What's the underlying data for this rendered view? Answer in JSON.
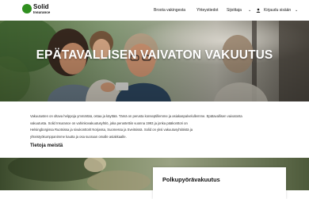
{
  "logo": {
    "name": "Solid",
    "tagline": "Insurance"
  },
  "nav": {
    "items": [
      {
        "label": "Broota vakingesta",
        "has_dropdown": false
      },
      {
        "label": "Yhteystiedot",
        "has_dropdown": false
      },
      {
        "label": "Sijoittaja",
        "has_dropdown": true
      },
      {
        "label": "Kirjaudu sisään",
        "has_dropdown": true
      }
    ],
    "user_icon": "user-icon",
    "caret_icon": "chevron-down-icon"
  },
  "hero": {
    "title": "EPÄTAVALLISEN VAIVATON VAKUUTUS"
  },
  "intro": {
    "lines": [
      "Vakuutusten on oltava helppoja ymmärtää, ostaa ja käyttää. Tämä on perusta konseptillemme ja asiakaspalvelullemme. Epätavallisen vaivatonta",
      "vakuutusta. Solid Insurance on vahinkovakuutusyhtiö, joka perustettiin vuonna 1993 ja jonka pääkonttori on",
      "Helsingborgissa Ruotsissa ja sivukonttorit Norjassa, Suomessa ja Sveitsissä. Solid on yksi vakuutusyhtiöistä ja",
      "yhteistyökumppanimme kautta ja osa suoraan omalle asiakkaalle."
    ]
  },
  "about_link": "Tietoja meistä",
  "card": {
    "title": "Polkupyörävakuutus"
  },
  "colors": {
    "brand_green": "#2f8f1f",
    "text": "#111111",
    "hero_text": "#ffffff"
  }
}
